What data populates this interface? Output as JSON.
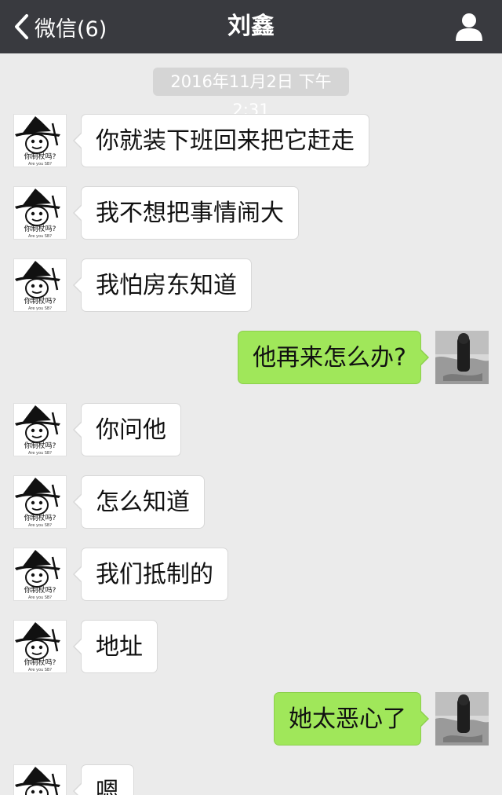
{
  "header": {
    "back_label": "微信(6)",
    "title": "刘鑫",
    "back_icon": "chevron-left-icon",
    "profile_icon": "person-icon",
    "bg_color": "#393a3f"
  },
  "timestamp": "2016年11月2日 下午2:31",
  "contact_avatar": {
    "caption": "你制杖吗?",
    "subcaption": "Are you SB?"
  },
  "colors": {
    "chat_bg": "#ebebeb",
    "incoming_bubble": "#ffffff",
    "outgoing_bubble": "#a0e75a"
  },
  "messages": [
    {
      "side": "in",
      "text": "你就装下班回来把它赶走"
    },
    {
      "side": "in",
      "text": "我不想把事情闹大"
    },
    {
      "side": "in",
      "text": "我怕房东知道"
    },
    {
      "side": "out",
      "text": "他再来怎么办?"
    },
    {
      "side": "in",
      "text": "你问他"
    },
    {
      "side": "in",
      "text": "怎么知道"
    },
    {
      "side": "in",
      "text": "我们抵制的"
    },
    {
      "side": "in",
      "text": "地址"
    },
    {
      "side": "out",
      "text": "她太恶心了"
    },
    {
      "side": "in",
      "text": "嗯"
    }
  ]
}
